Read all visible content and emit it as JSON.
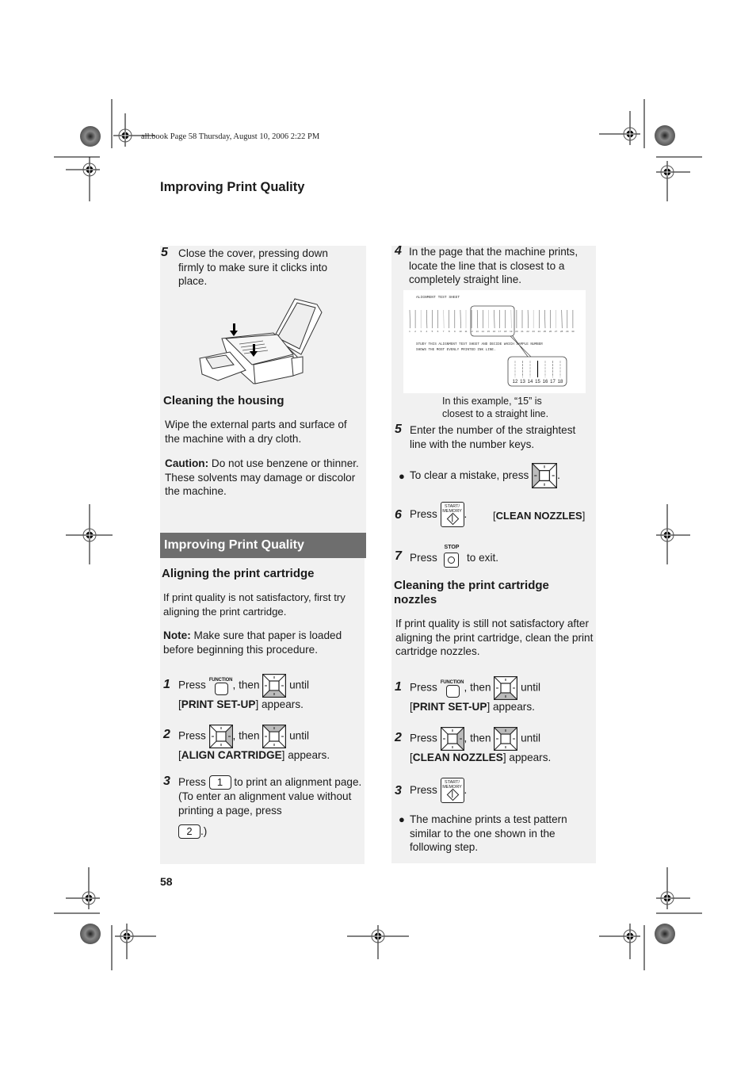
{
  "print_header": "all.book  Page 58  Thursday, August 10, 2006  2:22 PM",
  "page_title": "Improving Print Quality",
  "page_number": "58",
  "left_column": {
    "step5": {
      "num": "5",
      "text": "Close the cover, pressing down firmly to make sure it clicks into place.",
      "illustration": "fax-machine-cover-closing-illustration"
    },
    "housing": {
      "heading": "Cleaning the housing",
      "body": "Wipe the external parts and surface of the machine with a dry cloth.",
      "caution_label": "Caution:",
      "caution_text": " Do not use benzene or thinner. These solvents may damage or discolor the machine."
    },
    "section_bar": "Improving Print Quality",
    "aligning": {
      "heading": "Aligning the print cartridge",
      "body": "If print quality is not satisfactory, first try aligning the print cartridge.",
      "note_label": "Note:",
      "note_text": " Make sure that paper is loaded before beginning this procedure."
    },
    "steps": [
      {
        "num": "1",
        "press": "Press",
        "key1_label": "FUNCTION",
        "then": ", then",
        "until": "until",
        "bracket_open": "[",
        "display": "PRINT SET-UP",
        "bracket_close": "]",
        "appears": " appears."
      },
      {
        "num": "2",
        "press": "Press",
        "then": ", then",
        "until": "until",
        "bracket_open": "[",
        "display": "ALIGN CARTRIDGE",
        "bracket_close": "]",
        "appears": " appears."
      },
      {
        "num": "3",
        "press": "Press",
        "key": "1",
        "after_key": "to print an alignment page. (To enter an alignment value without printing a page, press",
        "key2": "2",
        "after_key2": ".)"
      }
    ]
  },
  "right_column": {
    "step4": {
      "num": "4",
      "text": "In the page that the machine prints, locate the line that is closest to a completely straight line."
    },
    "test_sheet": {
      "title": "ALIGNMENT TEST SHEET",
      "instructions_line1": "STUDY THIS ALIGNMENT TEST SHEET AND DECIDE WHICH SAMPLE NUMBER",
      "instructions_line2": "SHOWS THE MOST EVENLY PRINTED INK LINE.",
      "line_count": 30,
      "zoom_labels": [
        "12",
        "13",
        "14",
        "15",
        "16",
        "17",
        "18"
      ],
      "straightest": "15"
    },
    "caption": "In this example, “15” is closest to a straight line.",
    "step5": {
      "num": "5",
      "text": "Enter the number of the straightest line with the number keys."
    },
    "bullet_clear": {
      "text": "To clear a mistake, press",
      "end": "."
    },
    "step6": {
      "num": "6",
      "press": "Press",
      "key_label_1": "START/",
      "key_label_2": "MEMORY",
      "dot": ".",
      "display": "CLEAN NOZZLES"
    },
    "step7": {
      "num": "7",
      "press": "Press",
      "key_label": "STOP",
      "after": "to exit."
    },
    "nozzles": {
      "heading": "Cleaning the print cartridge nozzles",
      "body": "If print quality is still not satisfactory after aligning the print cartridge, clean the print cartridge nozzles."
    },
    "steps": [
      {
        "num": "1",
        "press": "Press",
        "key1_label": "FUNCTION",
        "then": ", then",
        "until": "until",
        "display": "PRINT SET-UP",
        "appears": " appears."
      },
      {
        "num": "2",
        "press": "Press",
        "then": ", then",
        "until": "until",
        "display": "CLEAN NOZZLES",
        "appears": " appears."
      },
      {
        "num": "3",
        "press": "Press",
        "key_label_1": "START/",
        "key_label_2": "MEMORY",
        "dot": "."
      }
    ],
    "bullet_final": "The machine prints a test pattern similar to the one shown in the following step."
  }
}
